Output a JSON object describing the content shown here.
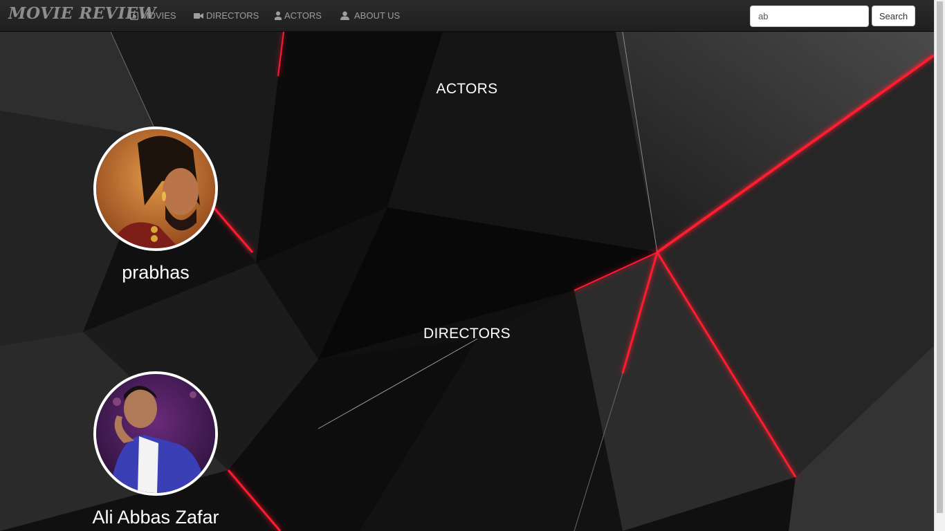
{
  "navbar": {
    "brand": "MOVIE REVIEW",
    "items": [
      {
        "label": "MOVIES",
        "icon": "play-icon"
      },
      {
        "label": "DIRECTORS",
        "icon": "video-camera-icon"
      },
      {
        "label": "ACTORS",
        "icon": "person-icon"
      },
      {
        "label": "ABOUT US",
        "icon": "user-icon"
      }
    ],
    "search": {
      "value": "ab",
      "button_label": "Search"
    }
  },
  "sections": {
    "actors": {
      "heading": "ACTORS",
      "results": [
        {
          "name": "prabhas"
        }
      ]
    },
    "directors": {
      "heading": "DIRECTORS",
      "results": [
        {
          "name": "Ali Abbas Zafar"
        }
      ]
    }
  },
  "colors": {
    "navbar": "#222222",
    "nav_text": "#9d9d9d",
    "accent_red": "#ff1a2e",
    "background": "#0c0c0c"
  }
}
